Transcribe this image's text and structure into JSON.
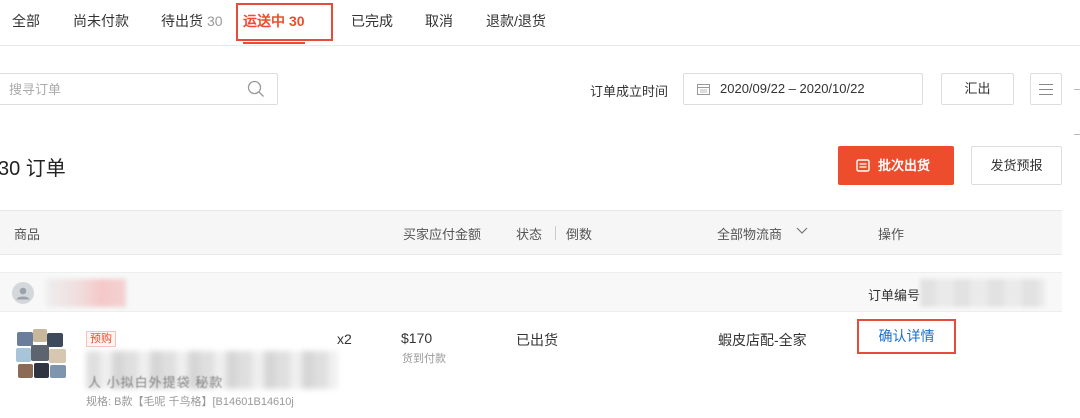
{
  "tabs": [
    {
      "label": "全部",
      "count": ""
    },
    {
      "label": "尚未付款",
      "count": ""
    },
    {
      "label": "待出货",
      "count": "30"
    },
    {
      "label": "运送中",
      "count": "30"
    },
    {
      "label": "已完成",
      "count": ""
    },
    {
      "label": "取消",
      "count": ""
    },
    {
      "label": "退款/退货",
      "count": ""
    }
  ],
  "search": {
    "placeholder": "搜寻订单",
    "value": ""
  },
  "date_filter": {
    "label": "订单成立时间",
    "range": "2020/09/22 – 2020/10/22"
  },
  "export_label": "汇出",
  "order_count": "30 订单",
  "batch_ship_label": "批次出货",
  "ship_report_label": "发货预报",
  "columns": {
    "product": "商品",
    "amount": "买家应付金额",
    "status": "状态",
    "countdown": "倒数",
    "carriers": "全部物流商",
    "actions": "操作"
  },
  "order": {
    "order_no_label": "订单编号",
    "pre_order_tag": "预购",
    "name_fragment": "人 小拟白外提袋 秘款",
    "qty": "x2",
    "spec": "规格: B款【毛呢 千鸟格】[B14601B14610j",
    "price": "$170",
    "payment": "货到付款",
    "status": "已出货",
    "carrier": "蝦皮店配-全家",
    "detail_label": "确认详情"
  },
  "colors": {
    "accent": "#ee4d2d",
    "link": "#1a6fd0",
    "highlight_box": "#e64b3b"
  }
}
